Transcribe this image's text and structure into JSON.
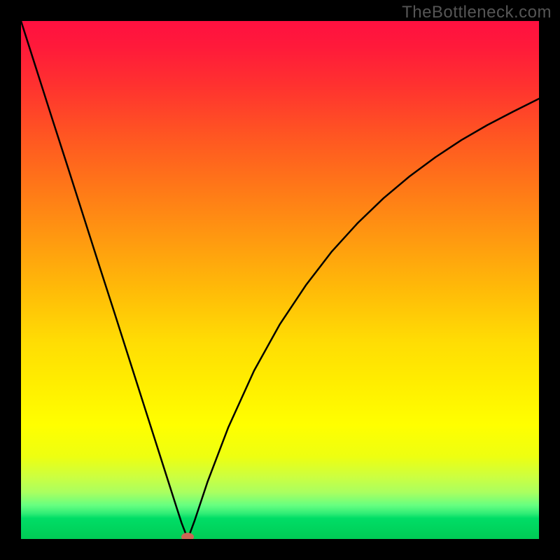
{
  "watermark": "TheBottleneck.com",
  "chart_data": {
    "type": "line",
    "title": "",
    "xlabel": "",
    "ylabel": "",
    "xlim": [
      0,
      100
    ],
    "ylim": [
      0,
      100
    ],
    "gradient_stops": [
      {
        "pos": 0,
        "color": "#ff1040"
      },
      {
        "pos": 12,
        "color": "#ff3030"
      },
      {
        "pos": 32,
        "color": "#ff7718"
      },
      {
        "pos": 52,
        "color": "#ffbb08"
      },
      {
        "pos": 70,
        "color": "#ffee00"
      },
      {
        "pos": 84,
        "color": "#ccff40"
      },
      {
        "pos": 96,
        "color": "#00dd66"
      },
      {
        "pos": 100,
        "color": "#00cc55"
      }
    ],
    "series": [
      {
        "name": "bottleneck-curve",
        "x": [
          0,
          3,
          6,
          9,
          12,
          15,
          18,
          21,
          24,
          27,
          30,
          31,
          32.2,
          33.5,
          36,
          40,
          45,
          50,
          55,
          60,
          65,
          70,
          75,
          80,
          85,
          90,
          95,
          100
        ],
        "y": [
          100,
          90.6,
          81.2,
          71.9,
          62.5,
          53.1,
          43.8,
          34.4,
          25.0,
          15.6,
          6.2,
          3.1,
          0,
          3.5,
          11.0,
          21.5,
          32.5,
          41.5,
          49.0,
          55.5,
          61.0,
          65.8,
          70.0,
          73.7,
          77.0,
          79.9,
          82.5,
          85.0
        ]
      }
    ],
    "marker": {
      "x": 32.2,
      "y": 0,
      "color": "#cc6655"
    },
    "vertex_x": 32.2
  }
}
